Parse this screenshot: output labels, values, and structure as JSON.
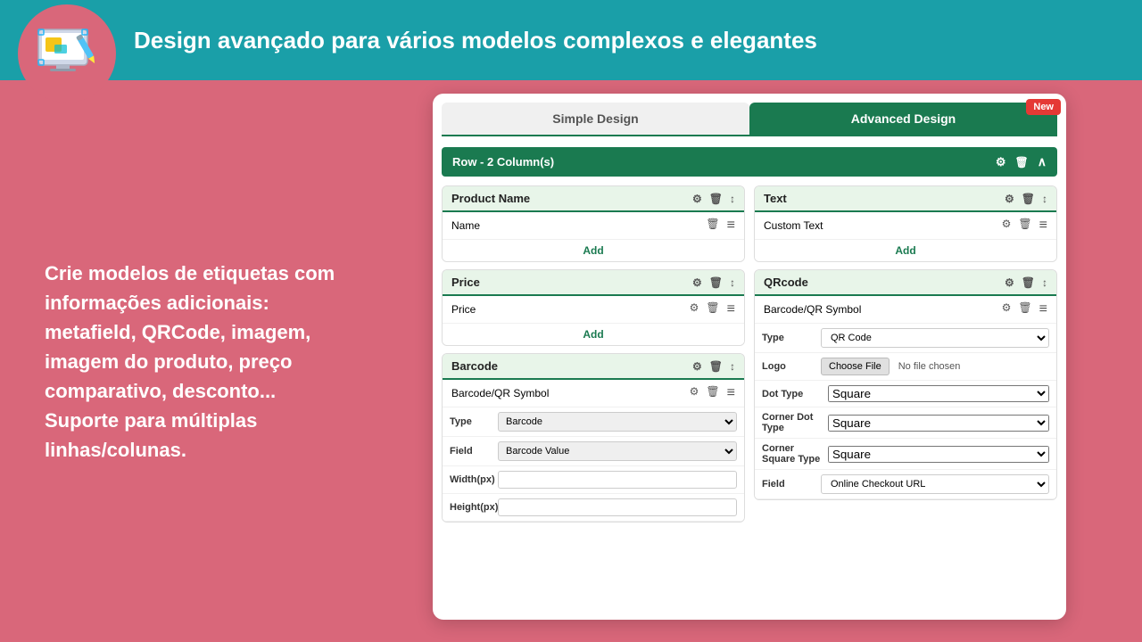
{
  "banner": {
    "title": "Design avançado para vários modelos complexos e elegantes",
    "bg_color": "#1a9fa8"
  },
  "left_panel": {
    "text": "Crie modelos de etiquetas com informações adicionais: metafield, QRCode, imagem, imagem do produto, preço comparativo, desconto... Suporte para múltiplas linhas/colunas."
  },
  "tabs": {
    "simple": "Simple Design",
    "advanced": "Advanced Design",
    "new_badge": "New"
  },
  "row_header": {
    "label": "Row - 2 Column(s)"
  },
  "left_col": {
    "product_name": {
      "header": "Product Name",
      "row_label": "Name",
      "add_label": "Add"
    },
    "price": {
      "header": "Price",
      "row_label": "Price",
      "add_label": "Add"
    },
    "barcode": {
      "header": "Barcode",
      "row_label": "Barcode/QR Symbol",
      "type_label": "Type",
      "type_value": "Barcode",
      "field_label": "Field",
      "field_value": "Barcode Value",
      "width_label": "Width(px)",
      "height_label": "Height(px)"
    }
  },
  "right_col": {
    "text_block": {
      "header": "Text",
      "row_label": "Custom Text",
      "add_label": "Add"
    },
    "qrcode": {
      "header": "QRcode",
      "row_label": "Barcode/QR Symbol",
      "type_label": "Type",
      "type_value": "QR Code",
      "logo_label": "Logo",
      "choose_file": "Choose File",
      "no_file": "No file chosen",
      "dot_type_label": "Dot Type",
      "dot_type_value": "Square",
      "corner_dot_type_label": "Corner Dot Type",
      "corner_dot_type_value": "Square",
      "corner_square_type_label": "Corner Square Type",
      "corner_square_type_value": "Square",
      "field_label": "Field",
      "field_value": "Online Checkout URL"
    }
  },
  "colors": {
    "green_dark": "#1a7a50",
    "teal": "#1a9fa8",
    "pink_bg": "#d9677a",
    "new_badge": "#e53935"
  }
}
